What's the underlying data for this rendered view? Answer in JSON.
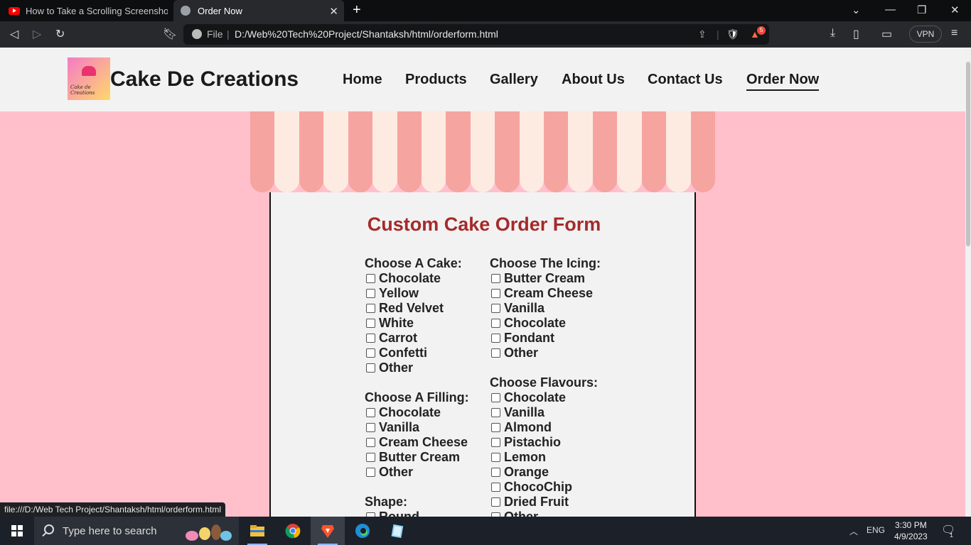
{
  "browser": {
    "tabs": [
      {
        "title": "How to Take a Scrolling Screenshot in",
        "active": false,
        "icon": "youtube-icon"
      },
      {
        "title": "Order Now",
        "active": true,
        "icon": "globe-icon"
      }
    ],
    "address": {
      "scheme_label": "File",
      "url": "D:/Web%20Tech%20Project/Shantaksh/html/orderform.html"
    },
    "shields_badge": "5",
    "vpn_label": "VPN"
  },
  "site": {
    "brand": "Cake De Creations",
    "logo_text": "Cake de Creations",
    "nav": [
      "Home",
      "Products",
      "Gallery",
      "About Us",
      "Contact Us",
      "Order Now"
    ],
    "active_nav": "Order Now"
  },
  "form": {
    "title": "Custom Cake Order Form",
    "cake": {
      "label": "Choose A Cake:",
      "options": [
        "Chocolate",
        "Yellow",
        "Red Velvet",
        "White",
        "Carrot",
        "Confetti",
        "Other"
      ]
    },
    "filling": {
      "label": "Choose A Filling:",
      "options": [
        "Chocolate",
        "Vanilla",
        "Cream Cheese",
        "Butter Cream",
        "Other"
      ]
    },
    "shape": {
      "label": "Shape:",
      "options": [
        "Round"
      ]
    },
    "icing": {
      "label": "Choose The Icing:",
      "options": [
        "Butter Cream",
        "Cream Cheese",
        "Vanilla",
        "Chocolate",
        "Fondant",
        "Other"
      ]
    },
    "flavours": {
      "label": "Choose Flavours:",
      "options": [
        "Chocolate",
        "Vanilla",
        "Almond",
        "Pistachio",
        "Lemon",
        "Orange",
        "ChocoChip",
        "Dried Fruit",
        "Other"
      ]
    }
  },
  "status_bar_url": "file:///D:/Web Tech Project/Shantaksh/html/orderform.html",
  "taskbar": {
    "search_placeholder": "Type here to search",
    "language": "ENG",
    "time": "3:30 PM",
    "date": "4/9/2023",
    "notification_count": "1"
  },
  "colors": {
    "page_bg": "#ffc0cb",
    "form_title": "#a52a2a",
    "awning_red": "#f6a4a0",
    "awning_cream": "#fdebe1"
  }
}
